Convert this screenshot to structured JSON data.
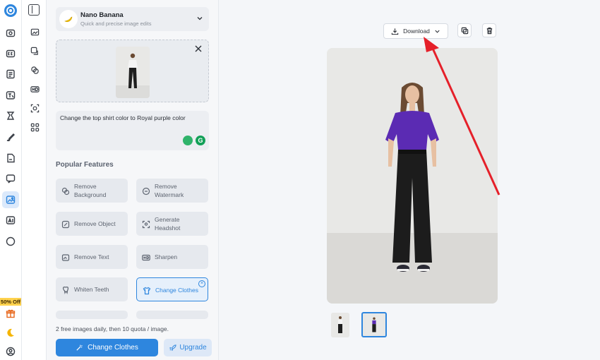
{
  "app": {
    "promo_badge": "50% Off"
  },
  "model": {
    "title": "Nano Banana",
    "subtitle": "Quick and precise image edits",
    "icon": "banana-icon"
  },
  "prompt": {
    "text": "Change the top shirt color to Royal purple color"
  },
  "features": {
    "title": "Popular Features",
    "items": [
      {
        "line1": "Remove",
        "line2": "Background",
        "icon": "remove-background-icon"
      },
      {
        "line1": "Remove",
        "line2": "Watermark",
        "icon": "remove-watermark-icon"
      },
      {
        "line1": "Remove Object",
        "line2": "",
        "icon": "remove-object-icon"
      },
      {
        "line1": "Generate",
        "line2": "Headshot",
        "icon": "headshot-icon"
      },
      {
        "line1": "Remove Text",
        "line2": "",
        "icon": "remove-text-icon"
      },
      {
        "line1": "Sharpen",
        "line2": "",
        "icon": "hd-icon"
      },
      {
        "line1": "Whiten Teeth",
        "line2": "",
        "icon": "tooth-icon"
      },
      {
        "line1": "Change Clothes",
        "line2": "",
        "icon": "shirt-icon",
        "active": true
      }
    ]
  },
  "footer": {
    "quota": "2 free images daily, then 10 quota / image.",
    "primary_label": "Change Clothes",
    "upgrade_label": "Upgrade"
  },
  "toolbar": {
    "download_label": "Download"
  },
  "colors": {
    "accent": "#2e86de",
    "shirt": "#5b2bb3",
    "arrow": "#e5202a",
    "promo": "#ffd24d"
  }
}
